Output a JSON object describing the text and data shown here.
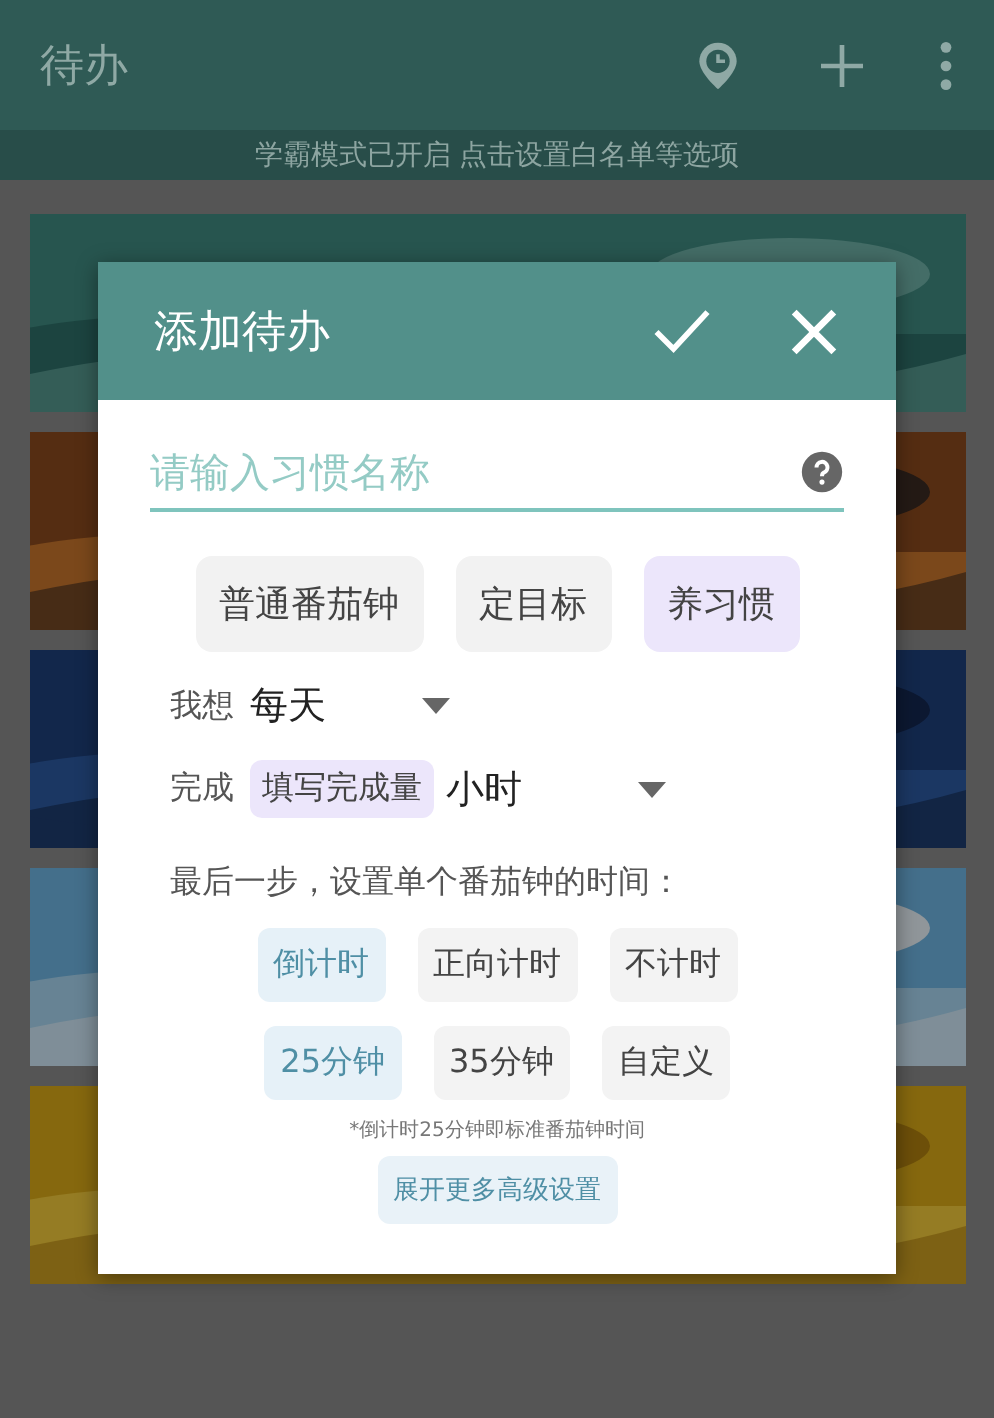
{
  "app_bar": {
    "title": "待办",
    "banner": "学霸模式已开启 点击设置白名单等选项"
  },
  "dialog": {
    "title": "添加待办",
    "name_field": {
      "placeholder": "请输入习惯名称"
    },
    "types": [
      {
        "label": "普通番茄钟",
        "selected": false
      },
      {
        "label": "定目标",
        "selected": false
      },
      {
        "label": "养习惯",
        "selected": true
      }
    ],
    "frequency": {
      "label": "我想",
      "value": "每天"
    },
    "completion": {
      "label": "完成",
      "tag": "填写完成量",
      "unit": "小时"
    },
    "step_text": "最后一步，设置单个番茄钟的时间：",
    "timer_modes": [
      {
        "label": "倒计时",
        "selected": true
      },
      {
        "label": "正向计时",
        "selected": false
      },
      {
        "label": "不计时",
        "selected": false
      }
    ],
    "durations": [
      {
        "label": "25分钟",
        "selected": true
      },
      {
        "label": "35分钟",
        "selected": false
      },
      {
        "label": "自定义",
        "selected": false
      }
    ],
    "note": "*倒计时25分钟即标准番茄钟时间",
    "more_button": "展开更多高级设置"
  }
}
